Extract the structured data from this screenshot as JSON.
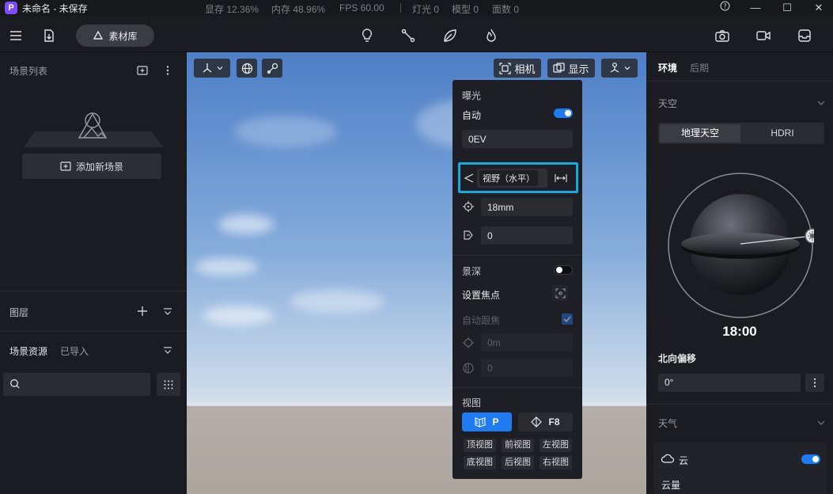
{
  "titlebar": {
    "logo": "P",
    "title": "未命名 - 未保存",
    "stats": [
      "显存 12.36%",
      "内存 48.96%",
      "FPS 60.00",
      "灯光 0",
      "模型 0",
      "面数 0"
    ],
    "controls": [
      "?",
      "—",
      "☐",
      "✕"
    ]
  },
  "toolbar": {
    "material_label": "素材库",
    "icons": [
      "menu-icon",
      "import-icon",
      "lightbulb-icon",
      "path-icon",
      "leaf-icon",
      "flame-icon",
      "camera-icon",
      "video-icon",
      "tray-icon"
    ]
  },
  "left": {
    "scene_list_title": "场景列表",
    "add_scene_label": "添加新场景",
    "layers_title": "图层",
    "assets_title": "场景资源",
    "assets_tab": "已导入"
  },
  "viewport": {
    "camera_label": "相机",
    "display_label": "显示"
  },
  "camera_panel": {
    "exposure_title": "曝光",
    "auto_label": "自动",
    "auto_on": true,
    "ev_value": "0EV",
    "fov_label": "视野（水平）",
    "focal_value": "18mm",
    "rotation_value": "0",
    "dof_title": "景深",
    "dof_on": false,
    "focus_label": "设置焦点",
    "autofocus_label": "自动跟焦",
    "focus_distance": "0m",
    "aperture": "0",
    "view_title": "视图",
    "persp_label": "P",
    "fov_btn_label": "F8",
    "views": [
      "顶视图",
      "前视图",
      "左视图",
      "底视图",
      "后视图",
      "右视图"
    ]
  },
  "right": {
    "tabs": [
      "环境",
      "后期"
    ],
    "sky_title": "天空",
    "sky_tabs": [
      "地理天空",
      "HDRI"
    ],
    "time": "18:00",
    "north_title": "北向偏移",
    "north_value": "0°",
    "weather_title": "天气",
    "cloud_label": "云",
    "cloud_on": true,
    "cloud_amount_label": "云量"
  },
  "colors": {
    "accent": "#1f7bf2",
    "highlight": "#19a7e0",
    "logo": "#7b4dff"
  }
}
